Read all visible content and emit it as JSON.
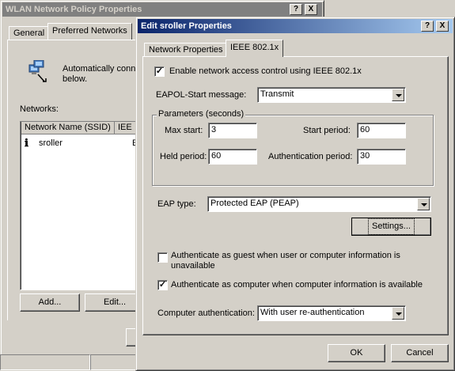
{
  "background_window": {
    "title": "WLAN Network Policy Properties",
    "title_buttons": [
      "?",
      "X"
    ],
    "tabs": [
      "General",
      "Preferred Networks"
    ],
    "description": "Automatically conne\nbelow.",
    "networks_label": "Networks:",
    "columns": [
      "Network Name (SSID)",
      "IEE"
    ],
    "rows": [
      {
        "ssid": "sroller",
        "ieee": "E"
      }
    ],
    "add_button": "Add...",
    "edit_button": "Edit..."
  },
  "dialog": {
    "title": "Edit sroller Properties",
    "title_buttons": [
      "?",
      "X"
    ],
    "tabs": [
      "Network Properties",
      "IEEE 802.1x"
    ],
    "active_tab": "IEEE 802.1x",
    "enable_8021x": {
      "label": "Enable network access control using IEEE 802.1x",
      "checked": true
    },
    "eapol": {
      "label": "EAPOL-Start message:",
      "value": "Transmit"
    },
    "parameters": {
      "group_label": "Parameters (seconds)",
      "max_start": {
        "label": "Max start:",
        "value": "3"
      },
      "start_period": {
        "label": "Start period:",
        "value": "60"
      },
      "held_period": {
        "label": "Held period:",
        "value": "60"
      },
      "auth_period": {
        "label": "Authentication period:",
        "value": "30"
      }
    },
    "eap_type": {
      "label": "EAP type:",
      "value": "Protected EAP (PEAP)"
    },
    "settings_button": "Settings...",
    "auth_as_guest": {
      "label": "Authenticate as guest when user or computer information is\nunavailable",
      "checked": false
    },
    "auth_as_computer": {
      "label": "Authenticate as computer when computer information is available",
      "checked": true
    },
    "computer_auth": {
      "label": "Computer authentication:",
      "value": "With user re-authentication"
    },
    "ok_button": "OK",
    "cancel_button": "Cancel"
  },
  "colors": {
    "face": "#d4d0c8",
    "active_title": "#0a246a",
    "inactive_title": "#808080"
  }
}
